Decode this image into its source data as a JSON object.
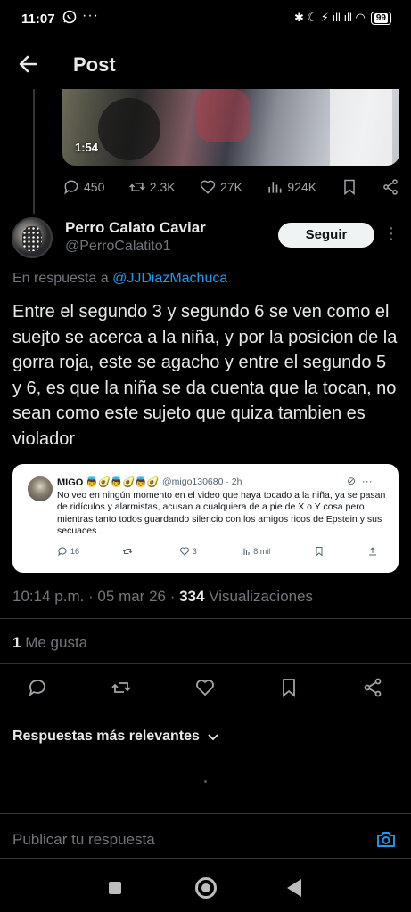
{
  "status_bar": {
    "time": "11:07",
    "whatsapp_icon": "whatsapp-icon",
    "more_dots": "···",
    "right_icons": "✱ ☾ ⚡ ıll ıll ◠",
    "battery": "99"
  },
  "header": {
    "title": "Post",
    "back_icon": "arrow-left-icon"
  },
  "parent_post": {
    "video_duration": "1:54",
    "replies": "450",
    "reposts": "2.3K",
    "likes": "27K",
    "views": "924K"
  },
  "post": {
    "author_name": "Perro Calato Caviar",
    "author_handle": "@PerroCalatito1",
    "follow_label": "Seguir",
    "reply_prefix": "En respuesta a",
    "reply_mention": "@JJDiazMachuca",
    "text": "Entre el segundo 3 y segundo 6 se ven como el suejto se acerca a la niña, y por la posicion de la gorra roja, este se agacho y entre el segundo 5 y 6, es que la niña se da cuenta que la tocan, no sean como este sujeto que quiza tambien es violador",
    "timestamp": "10:14 p.m. · 05 mar 26 · ",
    "views_count": "334",
    "views_label": " Visualizaciones",
    "likes_count": "1",
    "likes_label": " Me gusta"
  },
  "quote": {
    "name": "MIGO 👼🥑👼🥑👼🥑",
    "handle": "@migo130680 · 2h",
    "text": "No veo en ningún momento en el video que haya tocado a la niña, ya se pasan de ridículos y alarmistas, acusan a cualquiera de a pie de X o Y cosa pero mientras tanto todos guardando silencio con los amigos ricos de Epstein y sus secuaces...",
    "replies": "16",
    "reposts": "",
    "likes": "3",
    "views": "8 mil"
  },
  "replies_section": {
    "sort_label": "Respuestas más relevantes",
    "input_placeholder": "Publicar tu respuesta"
  }
}
